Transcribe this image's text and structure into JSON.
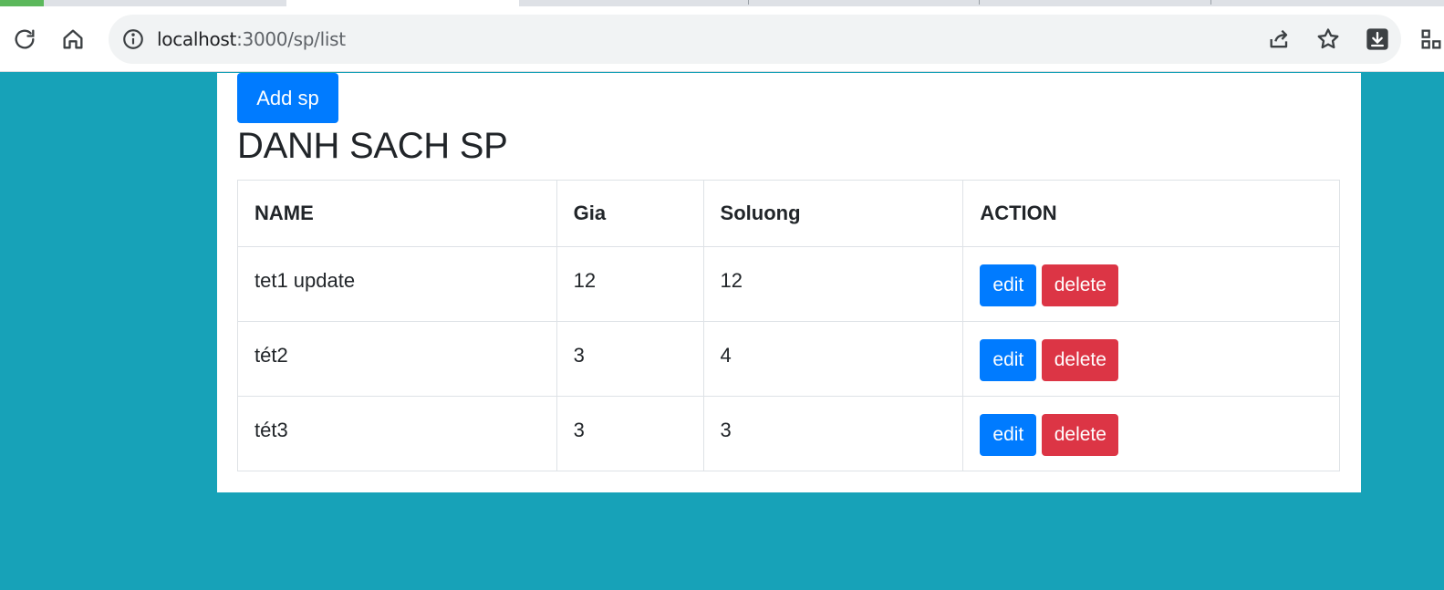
{
  "browser": {
    "url_host": "localhost",
    "url_rest": ":3000/sp/list"
  },
  "page": {
    "add_button": "Add sp",
    "title": "DANH SACH SP"
  },
  "table": {
    "headers": [
      "NAME",
      "Gia",
      "Soluong",
      "ACTION"
    ],
    "rows": [
      {
        "name": "tet1 update",
        "gia": "12",
        "soluong": "12",
        "edit": "edit",
        "delete": "delete"
      },
      {
        "name": "tét2",
        "gia": "3",
        "soluong": "4",
        "edit": "edit",
        "delete": "delete"
      },
      {
        "name": "tét3",
        "gia": "3",
        "soluong": "3",
        "edit": "edit",
        "delete": "delete"
      }
    ]
  },
  "colors": {
    "background": "#17a2b8",
    "primary": "#007bff",
    "danger": "#dc3545"
  },
  "icons": [
    "reload-icon",
    "home-icon",
    "site-info-icon",
    "share-icon",
    "bookmark-star-icon",
    "download-icon",
    "extensions-icon"
  ]
}
